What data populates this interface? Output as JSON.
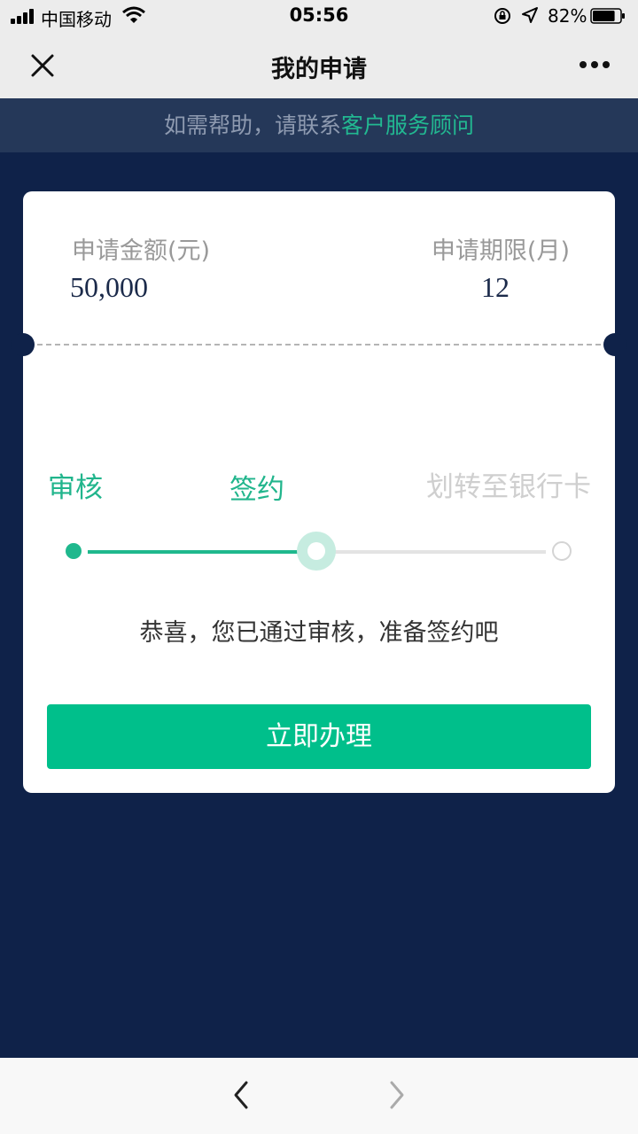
{
  "status_bar": {
    "carrier": "中国移动",
    "time": "05:56",
    "battery_percent": "82%",
    "battery_level": 0.82,
    "icons": [
      "signal-icon",
      "wifi-icon",
      "orientation-lock-icon",
      "location-icon",
      "battery-icon"
    ]
  },
  "nav": {
    "title": "我的申请",
    "close_icon": "close-icon",
    "more_icon": "more-icon"
  },
  "help": {
    "text": "如需帮助，请联系",
    "link": "客户服务顾问",
    "link_color": "#22b891"
  },
  "card": {
    "amount_label": "申请金额(元)",
    "amount_value": "50,000",
    "term_label": "申请期限(月)",
    "term_value": "12"
  },
  "progress": {
    "steps": [
      {
        "label": "审核",
        "state": "done"
      },
      {
        "label": "签约",
        "state": "current"
      },
      {
        "label": "划转至银行卡",
        "state": "pending"
      }
    ],
    "current_step_index": 1,
    "message": "恭喜，您已通过审核，准备签约吧"
  },
  "action": {
    "button_label": "立即办理",
    "button_color": "#00bf8b"
  },
  "toolbar": {
    "back_icon": "back-arrow-icon",
    "forward_icon": "forward-arrow-icon"
  },
  "colors": {
    "background": "#0f2249",
    "accent": "#21b58c"
  }
}
